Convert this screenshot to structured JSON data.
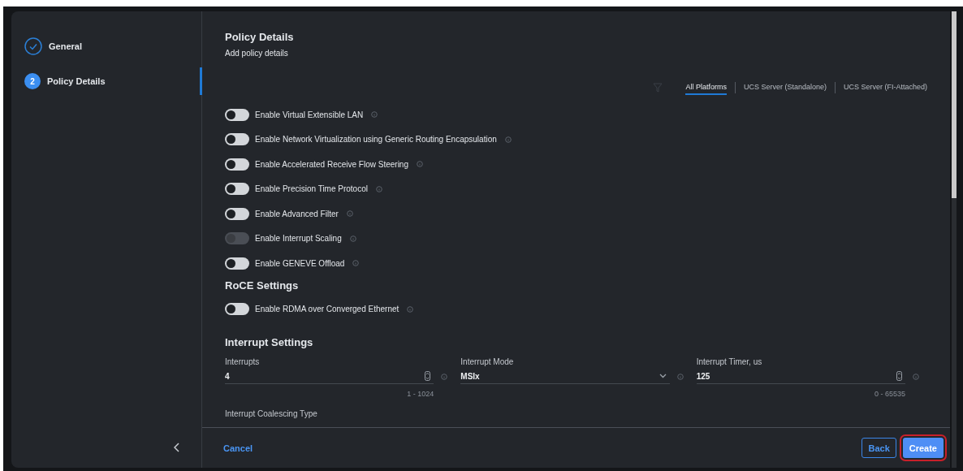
{
  "sidebar": {
    "steps": [
      {
        "label": "General",
        "done": true,
        "selected": false
      },
      {
        "number": "2",
        "label": "Policy Details",
        "done": false,
        "selected": true
      }
    ]
  },
  "header": {
    "title": "Policy Details",
    "subtitle": "Add policy details"
  },
  "platform_tabs": [
    {
      "label": "All Platforms",
      "selected": true
    },
    {
      "label": "UCS Server (Standalone)",
      "selected": false
    },
    {
      "label": "UCS Server (FI-Attached)",
      "selected": false
    }
  ],
  "toggles": [
    {
      "label": "Enable Virtual Extensible LAN",
      "on": false,
      "disabled": false
    },
    {
      "label": "Enable Network Virtualization using Generic Routing Encapsulation",
      "on": false,
      "disabled": false
    },
    {
      "label": "Enable Accelerated Receive Flow Steering",
      "on": false,
      "disabled": false
    },
    {
      "label": "Enable Precision Time Protocol",
      "on": false,
      "disabled": false
    },
    {
      "label": "Enable Advanced Filter",
      "on": false,
      "disabled": false
    },
    {
      "label": "Enable Interrupt Scaling",
      "on": false,
      "disabled": true
    },
    {
      "label": "Enable GENEVE Offload",
      "on": false,
      "disabled": false
    }
  ],
  "roce": {
    "heading": "RoCE Settings",
    "toggles": [
      {
        "label": "Enable RDMA over Converged Ethernet",
        "on": false,
        "disabled": false
      }
    ]
  },
  "interrupt": {
    "heading": "Interrupt Settings",
    "fields": [
      {
        "kind": "number",
        "label": "Interrupts",
        "value": "4",
        "hint": "1 - 1024"
      },
      {
        "kind": "select",
        "label": "Interrupt Mode",
        "value": "MSIx"
      },
      {
        "kind": "number",
        "label": "Interrupt Timer, us",
        "value": "125",
        "hint": "0 - 65535"
      }
    ],
    "next_label": "Interrupt Coalescing Type"
  },
  "footer": {
    "cancel": "Cancel",
    "back": "Back",
    "create": "Create",
    "create_highlighted": true
  }
}
